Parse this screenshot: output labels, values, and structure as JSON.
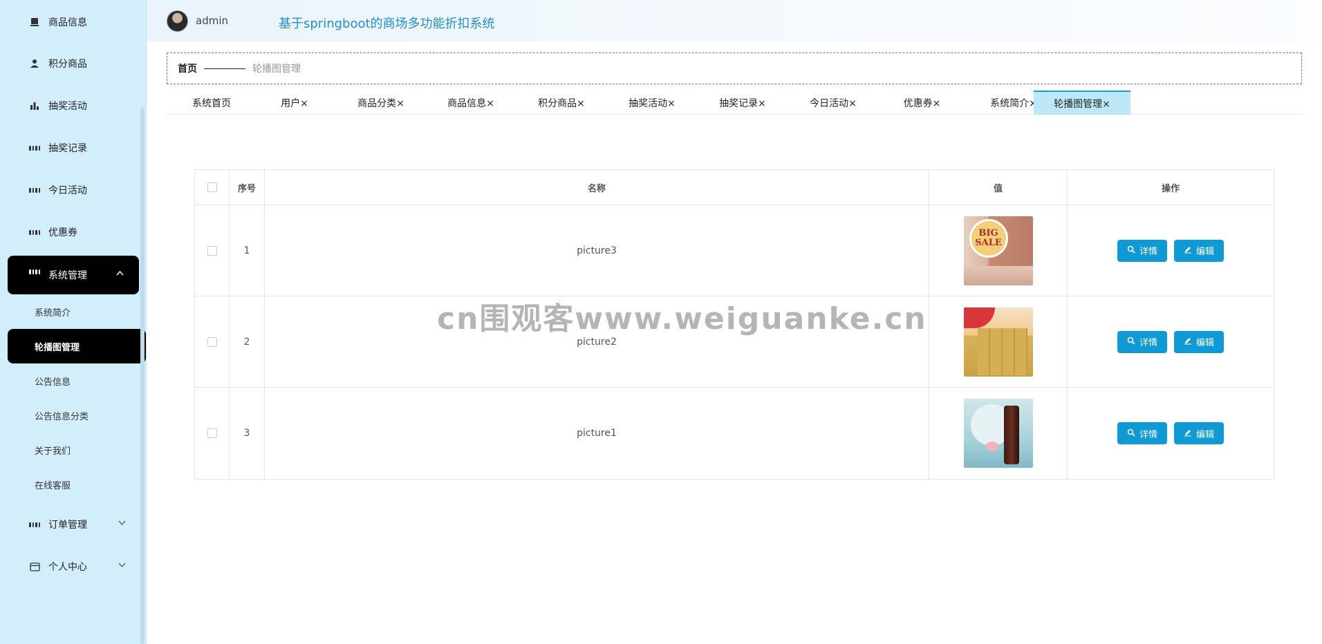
{
  "header": {
    "username": "admin",
    "system_title": "基于springboot的商场多功能折扣系统"
  },
  "sidebar": {
    "items": [
      {
        "label": "商品信息",
        "icon": "shop-icon"
      },
      {
        "label": "积分商品",
        "icon": "user-icon"
      },
      {
        "label": "抽奖活动",
        "icon": "bar-chart-icon"
      },
      {
        "label": "抽奖记录",
        "icon": "grid-icon"
      },
      {
        "label": "今日活动",
        "icon": "grid-icon"
      },
      {
        "label": "优惠券",
        "icon": "grid-icon"
      }
    ],
    "active_group": {
      "label": "系统管理",
      "icon": "grid-icon"
    },
    "sub_items": [
      "系统简介",
      "轮播图管理",
      "公告信息",
      "公告信息分类",
      "关于我们",
      "在线客服"
    ],
    "active_sub": "轮播图管理",
    "bottom_items": [
      {
        "label": "订单管理",
        "icon": "grid-icon"
      },
      {
        "label": "个人中心",
        "icon": "card-icon"
      }
    ]
  },
  "breadcrumb": {
    "home": "首页",
    "current": "轮播图管理"
  },
  "tabs": [
    "系统首页",
    "用户×",
    "商品分类×",
    "商品信息×",
    "积分商品×",
    "抽奖活动×",
    "抽奖记录×",
    "今日活动×",
    "优惠券×",
    "系统简介×",
    "轮播图管理×"
  ],
  "table": {
    "headers": [
      "序号",
      "名称",
      "值",
      "操作"
    ],
    "rows": [
      {
        "index": "1",
        "name": "picture3"
      },
      {
        "index": "2",
        "name": "picture2"
      },
      {
        "index": "3",
        "name": "picture1"
      }
    ],
    "detail_label": "详情",
    "edit_label": "编辑"
  },
  "thumb_badge": {
    "line1": "BIG",
    "line2": "SALE"
  },
  "watermark": "cn围观客www.weiguanke.cn",
  "colors": {
    "sidebar_bg": "#d2eefa",
    "accent": "#0f9ad6",
    "title": "#1e8fd6",
    "active_tab_bg": "#bde8fa"
  }
}
